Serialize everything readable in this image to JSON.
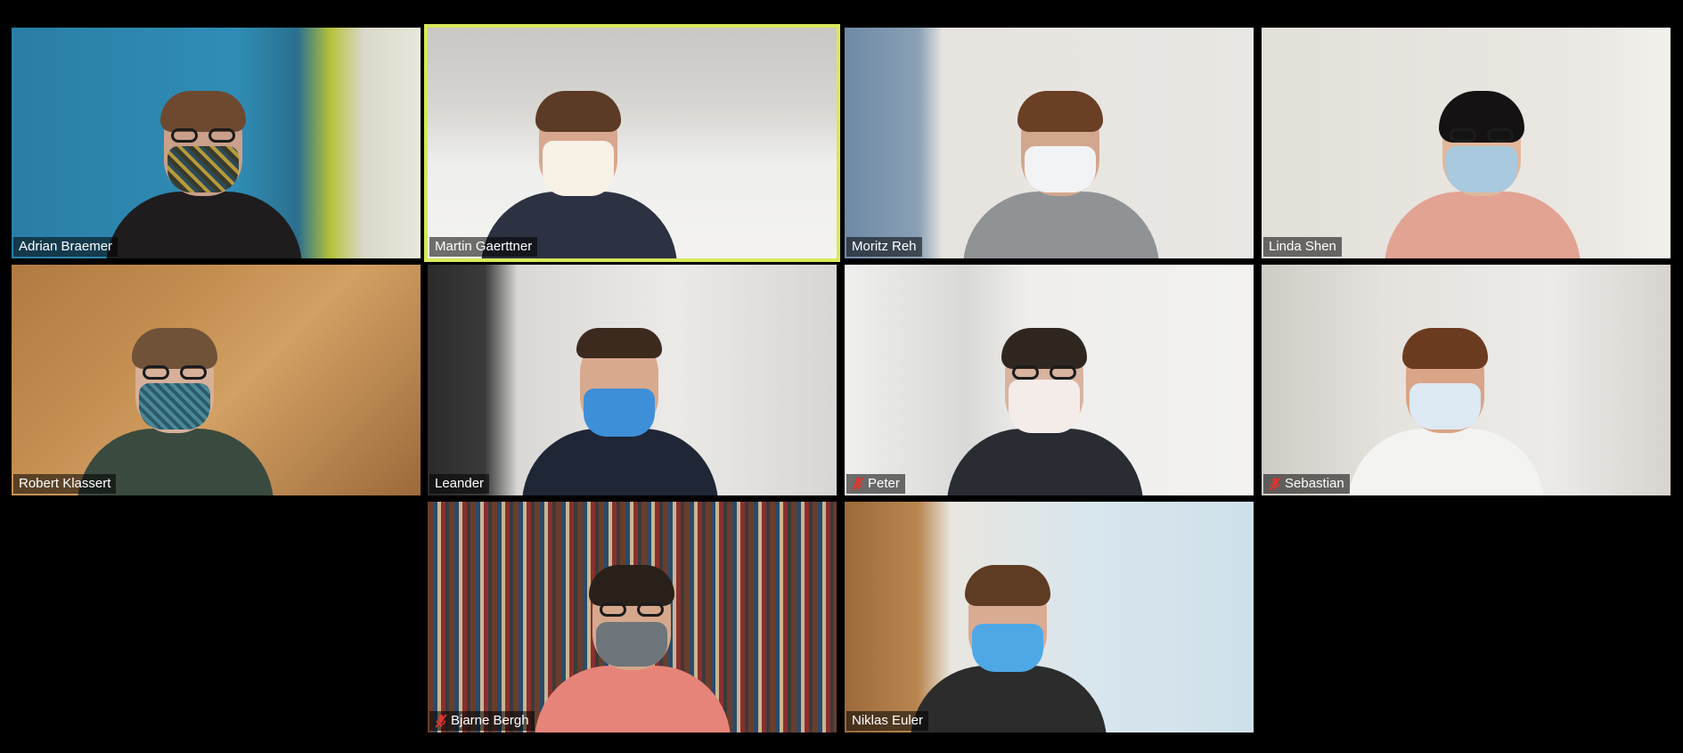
{
  "meeting": {
    "view": "gallery",
    "accent_active_speaker": "#d8e85a",
    "muted_icon_color": "#e0342f"
  },
  "participants": [
    {
      "name": "Adrian Braemer",
      "muted": false,
      "active_speaker": false
    },
    {
      "name": "Martin Gaerttner",
      "muted": false,
      "active_speaker": true
    },
    {
      "name": "Moritz Reh",
      "muted": false,
      "active_speaker": false
    },
    {
      "name": "Linda Shen",
      "muted": false,
      "active_speaker": false
    },
    {
      "name": "Robert Klassert",
      "muted": false,
      "active_speaker": false
    },
    {
      "name": "Leander",
      "muted": false,
      "active_speaker": false
    },
    {
      "name": "Peter",
      "muted": true,
      "active_speaker": false
    },
    {
      "name": "Sebastian",
      "muted": true,
      "active_speaker": false
    },
    {
      "name": "Bjarne Bergh",
      "muted": true,
      "active_speaker": false
    },
    {
      "name": "Niklas Euler",
      "muted": false,
      "active_speaker": false
    }
  ]
}
